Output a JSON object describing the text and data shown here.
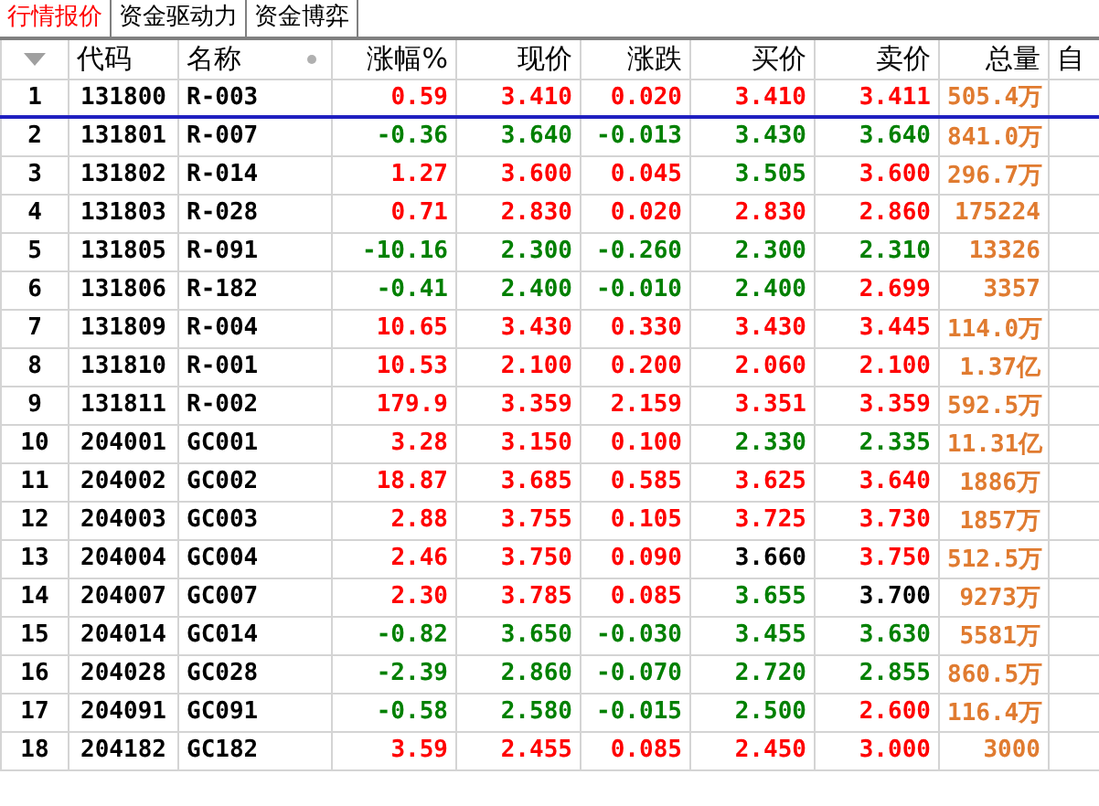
{
  "tabs": [
    {
      "label": "行情报价",
      "selected": true
    },
    {
      "label": "资金驱动力",
      "selected": false
    },
    {
      "label": "资金博弈",
      "selected": false
    }
  ],
  "columns": [
    "代码",
    "名称",
    "涨幅%",
    "现价",
    "涨跌",
    "买价",
    "卖价",
    "总量",
    "自"
  ],
  "rows": [
    {
      "index": "1",
      "code": "131800",
      "name": "R-003",
      "selected": true,
      "cells": [
        {
          "text": "0.59",
          "color": "#ff0000"
        },
        {
          "text": "3.410",
          "color": "#ff0000"
        },
        {
          "text": "0.020",
          "color": "#ff0000"
        },
        {
          "text": "3.410",
          "color": "#ff0000"
        },
        {
          "text": "3.411",
          "color": "#ff0000"
        }
      ],
      "volume": "505.4万"
    },
    {
      "index": "2",
      "code": "131801",
      "name": "R-007",
      "selected": false,
      "cells": [
        {
          "text": "-0.36",
          "color": "#008000"
        },
        {
          "text": "3.640",
          "color": "#008000"
        },
        {
          "text": "-0.013",
          "color": "#008000"
        },
        {
          "text": "3.430",
          "color": "#008000"
        },
        {
          "text": "3.640",
          "color": "#008000"
        }
      ],
      "volume": "841.0万"
    },
    {
      "index": "3",
      "code": "131802",
      "name": "R-014",
      "selected": false,
      "cells": [
        {
          "text": "1.27",
          "color": "#ff0000"
        },
        {
          "text": "3.600",
          "color": "#ff0000"
        },
        {
          "text": "0.045",
          "color": "#ff0000"
        },
        {
          "text": "3.505",
          "color": "#008000"
        },
        {
          "text": "3.600",
          "color": "#ff0000"
        }
      ],
      "volume": "296.7万"
    },
    {
      "index": "4",
      "code": "131803",
      "name": "R-028",
      "selected": false,
      "cells": [
        {
          "text": "0.71",
          "color": "#ff0000"
        },
        {
          "text": "2.830",
          "color": "#ff0000"
        },
        {
          "text": "0.020",
          "color": "#ff0000"
        },
        {
          "text": "2.830",
          "color": "#ff0000"
        },
        {
          "text": "2.860",
          "color": "#ff0000"
        }
      ],
      "volume": "175224"
    },
    {
      "index": "5",
      "code": "131805",
      "name": "R-091",
      "selected": false,
      "cells": [
        {
          "text": "-10.16",
          "color": "#008000"
        },
        {
          "text": "2.300",
          "color": "#008000"
        },
        {
          "text": "-0.260",
          "color": "#008000"
        },
        {
          "text": "2.300",
          "color": "#008000"
        },
        {
          "text": "2.310",
          "color": "#008000"
        }
      ],
      "volume": "13326"
    },
    {
      "index": "6",
      "code": "131806",
      "name": "R-182",
      "selected": false,
      "cells": [
        {
          "text": "-0.41",
          "color": "#008000"
        },
        {
          "text": "2.400",
          "color": "#008000"
        },
        {
          "text": "-0.010",
          "color": "#008000"
        },
        {
          "text": "2.400",
          "color": "#008000"
        },
        {
          "text": "2.699",
          "color": "#ff0000"
        }
      ],
      "volume": "3357"
    },
    {
      "index": "7",
      "code": "131809",
      "name": "R-004",
      "selected": false,
      "cells": [
        {
          "text": "10.65",
          "color": "#ff0000"
        },
        {
          "text": "3.430",
          "color": "#ff0000"
        },
        {
          "text": "0.330",
          "color": "#ff0000"
        },
        {
          "text": "3.430",
          "color": "#ff0000"
        },
        {
          "text": "3.445",
          "color": "#ff0000"
        }
      ],
      "volume": "114.0万"
    },
    {
      "index": "8",
      "code": "131810",
      "name": "R-001",
      "selected": false,
      "cells": [
        {
          "text": "10.53",
          "color": "#ff0000"
        },
        {
          "text": "2.100",
          "color": "#ff0000"
        },
        {
          "text": "0.200",
          "color": "#ff0000"
        },
        {
          "text": "2.060",
          "color": "#ff0000"
        },
        {
          "text": "2.100",
          "color": "#ff0000"
        }
      ],
      "volume": "1.37亿"
    },
    {
      "index": "9",
      "code": "131811",
      "name": "R-002",
      "selected": false,
      "cells": [
        {
          "text": "179.9",
          "color": "#ff0000"
        },
        {
          "text": "3.359",
          "color": "#ff0000"
        },
        {
          "text": "2.159",
          "color": "#ff0000"
        },
        {
          "text": "3.351",
          "color": "#ff0000"
        },
        {
          "text": "3.359",
          "color": "#ff0000"
        }
      ],
      "volume": "592.5万"
    },
    {
      "index": "10",
      "code": "204001",
      "name": "GC001",
      "selected": false,
      "cells": [
        {
          "text": "3.28",
          "color": "#ff0000"
        },
        {
          "text": "3.150",
          "color": "#ff0000"
        },
        {
          "text": "0.100",
          "color": "#ff0000"
        },
        {
          "text": "2.330",
          "color": "#008000"
        },
        {
          "text": "2.335",
          "color": "#008000"
        }
      ],
      "volume": "11.31亿"
    },
    {
      "index": "11",
      "code": "204002",
      "name": "GC002",
      "selected": false,
      "cells": [
        {
          "text": "18.87",
          "color": "#ff0000"
        },
        {
          "text": "3.685",
          "color": "#ff0000"
        },
        {
          "text": "0.585",
          "color": "#ff0000"
        },
        {
          "text": "3.625",
          "color": "#ff0000"
        },
        {
          "text": "3.640",
          "color": "#ff0000"
        }
      ],
      "volume": "1886万"
    },
    {
      "index": "12",
      "code": "204003",
      "name": "GC003",
      "selected": false,
      "cells": [
        {
          "text": "2.88",
          "color": "#ff0000"
        },
        {
          "text": "3.755",
          "color": "#ff0000"
        },
        {
          "text": "0.105",
          "color": "#ff0000"
        },
        {
          "text": "3.725",
          "color": "#ff0000"
        },
        {
          "text": "3.730",
          "color": "#ff0000"
        }
      ],
      "volume": "1857万"
    },
    {
      "index": "13",
      "code": "204004",
      "name": "GC004",
      "selected": false,
      "cells": [
        {
          "text": "2.46",
          "color": "#ff0000"
        },
        {
          "text": "3.750",
          "color": "#ff0000"
        },
        {
          "text": "0.090",
          "color": "#ff0000"
        },
        {
          "text": "3.660",
          "color": "#000000"
        },
        {
          "text": "3.750",
          "color": "#ff0000"
        }
      ],
      "volume": "512.5万"
    },
    {
      "index": "14",
      "code": "204007",
      "name": "GC007",
      "selected": false,
      "cells": [
        {
          "text": "2.30",
          "color": "#ff0000"
        },
        {
          "text": "3.785",
          "color": "#ff0000"
        },
        {
          "text": "0.085",
          "color": "#ff0000"
        },
        {
          "text": "3.655",
          "color": "#008000"
        },
        {
          "text": "3.700",
          "color": "#000000"
        }
      ],
      "volume": "9273万"
    },
    {
      "index": "15",
      "code": "204014",
      "name": "GC014",
      "selected": false,
      "cells": [
        {
          "text": "-0.82",
          "color": "#008000"
        },
        {
          "text": "3.650",
          "color": "#008000"
        },
        {
          "text": "-0.030",
          "color": "#008000"
        },
        {
          "text": "3.455",
          "color": "#008000"
        },
        {
          "text": "3.630",
          "color": "#008000"
        }
      ],
      "volume": "5581万"
    },
    {
      "index": "16",
      "code": "204028",
      "name": "GC028",
      "selected": false,
      "cells": [
        {
          "text": "-2.39",
          "color": "#008000"
        },
        {
          "text": "2.860",
          "color": "#008000"
        },
        {
          "text": "-0.070",
          "color": "#008000"
        },
        {
          "text": "2.720",
          "color": "#008000"
        },
        {
          "text": "2.855",
          "color": "#008000"
        }
      ],
      "volume": "860.5万"
    },
    {
      "index": "17",
      "code": "204091",
      "name": "GC091",
      "selected": false,
      "cells": [
        {
          "text": "-0.58",
          "color": "#008000"
        },
        {
          "text": "2.580",
          "color": "#008000"
        },
        {
          "text": "-0.015",
          "color": "#008000"
        },
        {
          "text": "2.500",
          "color": "#008000"
        },
        {
          "text": "2.600",
          "color": "#ff0000"
        }
      ],
      "volume": "116.4万"
    },
    {
      "index": "18",
      "code": "204182",
      "name": "GC182",
      "selected": false,
      "cells": [
        {
          "text": "3.59",
          "color": "#ff0000"
        },
        {
          "text": "2.455",
          "color": "#ff0000"
        },
        {
          "text": "0.085",
          "color": "#ff0000"
        },
        {
          "text": "2.450",
          "color": "#ff0000"
        },
        {
          "text": "3.000",
          "color": "#ff0000"
        }
      ],
      "volume": "3000"
    }
  ]
}
